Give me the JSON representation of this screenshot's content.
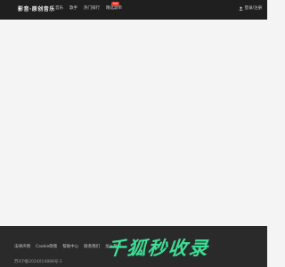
{
  "header": {
    "logo_text": "影音·原创音乐",
    "nav": [
      {
        "label": "音乐"
      },
      {
        "label": "歌手"
      },
      {
        "label": "热门排行"
      },
      {
        "label": "精选歌单"
      }
    ],
    "hot_badge": "hot",
    "login_label": "登录/注册"
  },
  "footer": {
    "links": [
      {
        "label": "法律声明"
      },
      {
        "label": "Cookie政策"
      },
      {
        "label": "帮助中心"
      },
      {
        "label": "联系我们"
      },
      {
        "label": "加入我们"
      }
    ],
    "icp": "苏ICP备2024014888号-1",
    "brand_logo_text": "千狐秒收录"
  },
  "colors": {
    "header_bg": "#1f1f1f",
    "footer_bg": "#2a2a2a",
    "brand_accent": "#3dde95",
    "badge_red": "#e8362c"
  }
}
